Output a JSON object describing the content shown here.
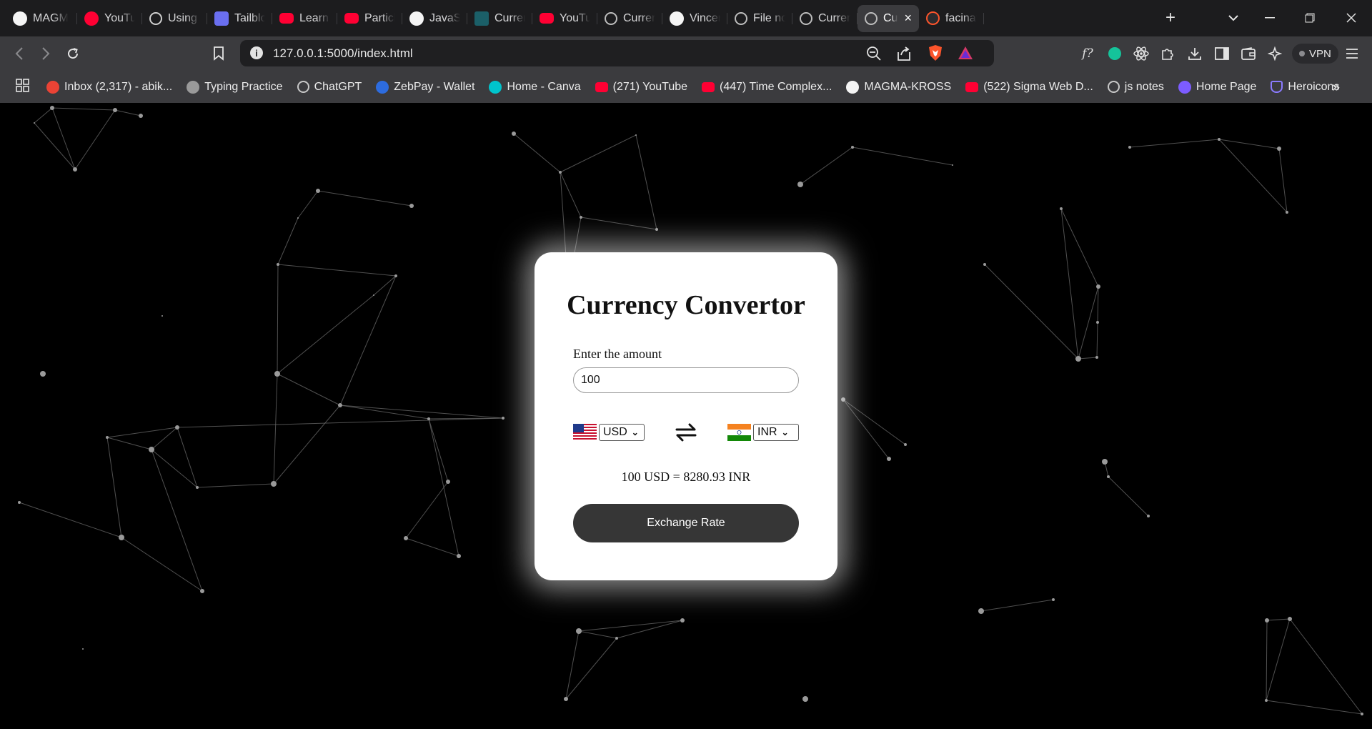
{
  "browser": {
    "tabs": [
      {
        "label": "MAGM",
        "icon": "github-icon",
        "kind": "gh"
      },
      {
        "label": "YouTul",
        "icon": "youtube-icon",
        "kind": "yt-round"
      },
      {
        "label": "Using C",
        "icon": "chatgpt-icon",
        "kind": "gpt"
      },
      {
        "label": "Tailblo",
        "icon": "tailblocks-icon",
        "kind": "tw"
      },
      {
        "label": "Learn E",
        "icon": "youtube-icon",
        "kind": "yt"
      },
      {
        "label": "Particle",
        "icon": "youtube-icon",
        "kind": "yt"
      },
      {
        "label": "JavaScr",
        "icon": "github-icon",
        "kind": "gh"
      },
      {
        "label": "Curren",
        "icon": "frontend-mentor-icon",
        "kind": "f"
      },
      {
        "label": "YouTul",
        "icon": "youtube-icon",
        "kind": "yt"
      },
      {
        "label": "Curren",
        "icon": "globe-icon",
        "kind": "globe"
      },
      {
        "label": "Vincen",
        "icon": "github-icon",
        "kind": "gh"
      },
      {
        "label": "File no",
        "icon": "globe-icon",
        "kind": "globe"
      },
      {
        "label": "Curren",
        "icon": "globe-icon",
        "kind": "globe"
      },
      {
        "label": "Cu",
        "icon": "globe-icon",
        "kind": "globe",
        "active": true
      },
      {
        "label": "facinat",
        "icon": "brave-icon",
        "kind": "brave"
      }
    ],
    "url": "127.0.0.1:5000/index.html",
    "vpn_label": "VPN",
    "bookmarks": [
      {
        "label": "Inbox (2,317) - abik...",
        "icon": "gmail-icon"
      },
      {
        "label": "Typing Practice",
        "icon": "typing-icon"
      },
      {
        "label": "ChatGPT",
        "icon": "chatgpt-icon"
      },
      {
        "label": "ZebPay - Wallet",
        "icon": "zebpay-icon"
      },
      {
        "label": "Home - Canva",
        "icon": "canva-icon"
      },
      {
        "label": "(271) YouTube",
        "icon": "youtube-icon"
      },
      {
        "label": "(447) Time Complex...",
        "icon": "youtube-icon"
      },
      {
        "label": "MAGMA-KROSS",
        "icon": "github-icon"
      },
      {
        "label": "(522) Sigma Web D...",
        "icon": "youtube-icon"
      },
      {
        "label": "js notes",
        "icon": "globe-icon"
      },
      {
        "label": "Home Page",
        "icon": "home-page-icon"
      },
      {
        "label": "Heroicons",
        "icon": "heroicons-icon"
      }
    ],
    "colors": {
      "chrome_dark": "#1c1c1e",
      "chrome_bar": "#3b3b3e",
      "address_bg": "#1f1f21"
    }
  },
  "converter": {
    "title": "Currency Convertor",
    "amount_label": "Enter the amount",
    "amount_value": "100",
    "from_currency": "USD",
    "to_currency": "INR",
    "from_flag": "us-flag",
    "to_flag": "india-flag",
    "result_text": "100 USD = 8280.93 INR",
    "button_label": "Exchange Rate",
    "colors": {
      "card_bg": "#ffffff",
      "button_bg": "#363636",
      "page_bg": "#000000"
    }
  }
}
